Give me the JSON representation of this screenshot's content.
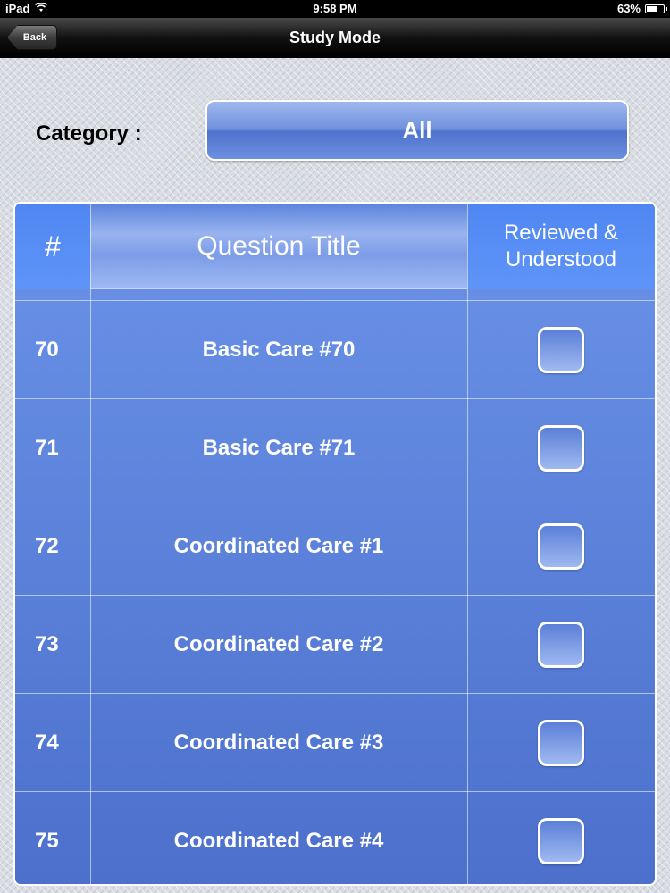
{
  "status_bar": {
    "device": "iPad",
    "time": "9:58 PM",
    "battery_text": "63%",
    "battery_level": 0.63
  },
  "nav": {
    "back_label": "Back",
    "title": "Study Mode"
  },
  "category": {
    "label": "Category :",
    "value": "All"
  },
  "table": {
    "headers": {
      "number": "#",
      "title": "Question Title",
      "reviewed_line1": "Reviewed &",
      "reviewed_line2": "Understood"
    },
    "rows": [
      {
        "number": "70",
        "title": "Basic Care #70",
        "checked": false
      },
      {
        "number": "71",
        "title": "Basic Care #71",
        "checked": false
      },
      {
        "number": "72",
        "title": "Coordinated Care #1",
        "checked": false
      },
      {
        "number": "73",
        "title": "Coordinated Care #2",
        "checked": false
      },
      {
        "number": "74",
        "title": "Coordinated Care #3",
        "checked": false
      },
      {
        "number": "75",
        "title": "Coordinated Care #4",
        "checked": false
      }
    ]
  }
}
